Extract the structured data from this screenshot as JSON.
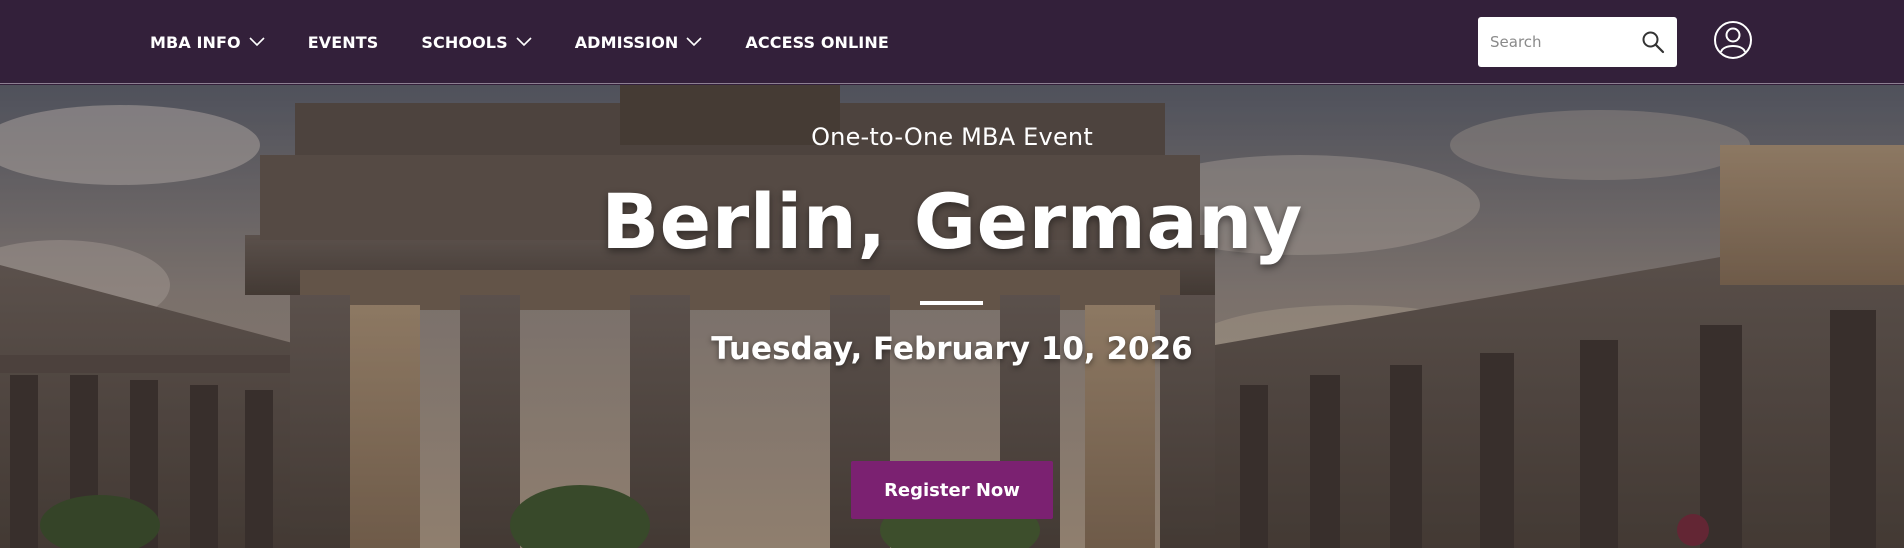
{
  "nav": {
    "items": [
      {
        "label": "MBA INFO",
        "has_dropdown": true
      },
      {
        "label": "EVENTS",
        "has_dropdown": false
      },
      {
        "label": "SCHOOLS",
        "has_dropdown": true
      },
      {
        "label": "ADMISSION",
        "has_dropdown": true
      },
      {
        "label": "ACCESS ONLINE",
        "has_dropdown": false
      }
    ],
    "search": {
      "placeholder": "Search",
      "value": "",
      "icon": "search-icon"
    },
    "account_icon": "user-icon"
  },
  "hero": {
    "eyebrow": "One-to-One MBA Event",
    "title": "Berlin, Germany",
    "date": "Tuesday, February 10, 2026",
    "cta_label": "Register Now",
    "background_image": "Brandenburg Gate, Berlin"
  },
  "colors": {
    "nav_background": "#33203a",
    "cta_background": "#7b2171",
    "text": "#ffffff"
  }
}
